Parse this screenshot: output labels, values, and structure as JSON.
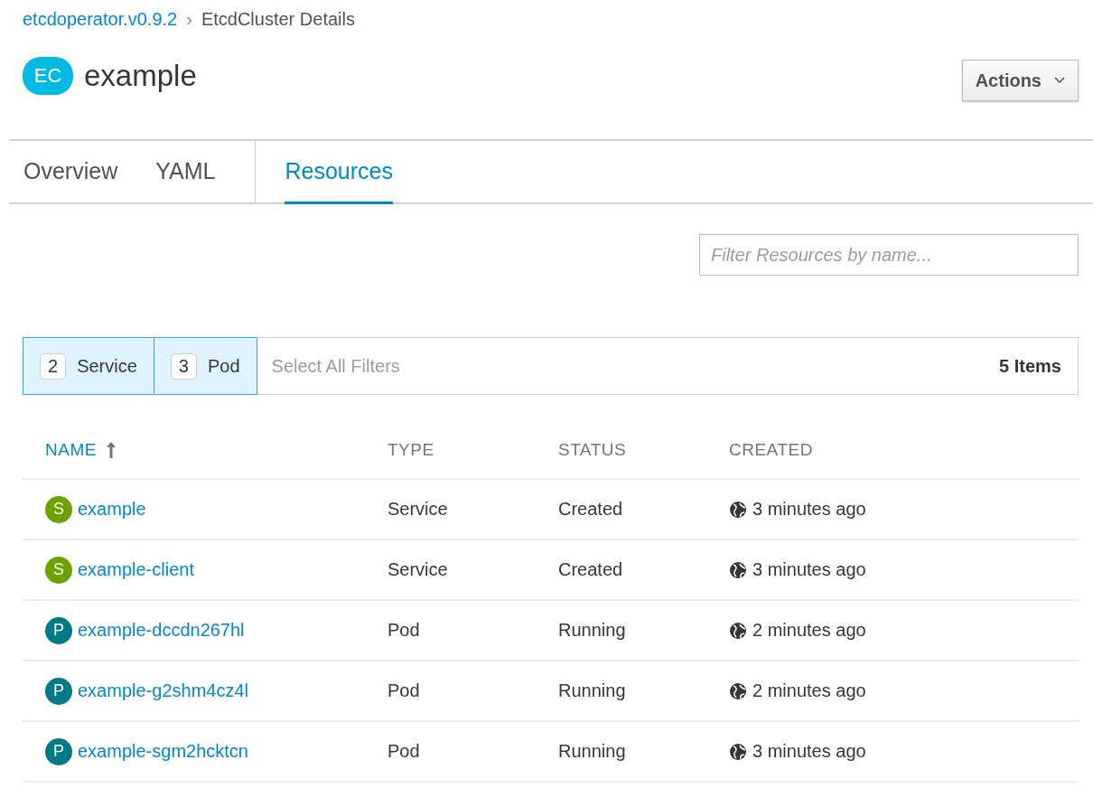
{
  "breadcrumb": {
    "link": "etcdoperator.v0.9.2",
    "separator": "›",
    "current": "EtcdCluster Details"
  },
  "header": {
    "badge": "EC",
    "title": "example",
    "actions_button": "Actions"
  },
  "tabs": [
    {
      "label": "Overview",
      "selected": false
    },
    {
      "label": "YAML",
      "selected": false
    },
    {
      "label": "Resources",
      "selected": true
    }
  ],
  "search": {
    "placeholder": "Filter Resources by name..."
  },
  "filters": {
    "chips": [
      {
        "count": "2",
        "label": "Service",
        "selected": true
      },
      {
        "count": "3",
        "label": "Pod",
        "selected": true
      }
    ],
    "select_all": "Select All Filters",
    "total": "5 Items"
  },
  "table": {
    "columns": [
      {
        "label": "NAME",
        "sorted": true
      },
      {
        "label": "TYPE",
        "sorted": false
      },
      {
        "label": "STATUS",
        "sorted": false
      },
      {
        "label": "CREATED",
        "sorted": false
      }
    ],
    "rows": [
      {
        "badge": "S",
        "color": "#6ca100",
        "name": "example",
        "type": "Service",
        "status": "Created",
        "created": "3 minutes ago"
      },
      {
        "badge": "S",
        "color": "#6ca100",
        "name": "example-client",
        "type": "Service",
        "status": "Created",
        "created": "3 minutes ago"
      },
      {
        "badge": "P",
        "color": "#007a87",
        "name": "example-dccdn267hl",
        "type": "Pod",
        "status": "Running",
        "created": "2 minutes ago"
      },
      {
        "badge": "P",
        "color": "#007a87",
        "name": "example-g2shm4cz4l",
        "type": "Pod",
        "status": "Running",
        "created": "2 minutes ago"
      },
      {
        "badge": "P",
        "color": "#007a87",
        "name": "example-sgm2hcktcn",
        "type": "Pod",
        "status": "Running",
        "created": "3 minutes ago"
      }
    ]
  }
}
